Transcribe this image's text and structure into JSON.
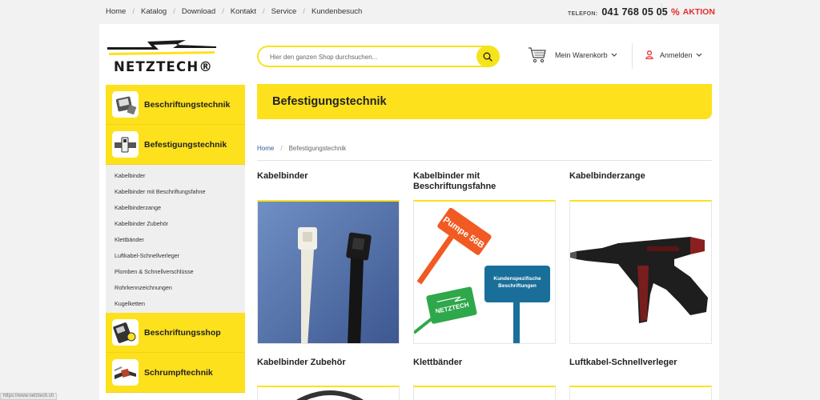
{
  "topnav": {
    "links": [
      "Home",
      "Katalog",
      "Download",
      "Kontakt",
      "Service",
      "Kundenbesuch"
    ],
    "phone_label": "TELEFON:",
    "phone_number": "041 768 05 05",
    "aktion_symbol": "%",
    "aktion_label": "AKTION"
  },
  "header": {
    "logo_text": "NETZTECH®",
    "search_placeholder": "Hier den ganzen Shop durchsuchen...",
    "cart_label": "Mein Warenkorb",
    "login_label": "Anmelden"
  },
  "sidebar": {
    "categories": [
      {
        "label": "Beschriftungstechnik",
        "icon": "label-tag-icon"
      },
      {
        "label": "Befestigungstechnik",
        "icon": "cable-tie-icon"
      }
    ],
    "subitems": [
      "Kabelbinder",
      "Kabelbinder mit Beschriftungsfahne",
      "Kabelbinderzange",
      "Kabelbinder Zubehör",
      "Klettbänder",
      "Luftkabel-Schnellverleger",
      "Plomben & Schnellverschlüsse",
      "Rohrkennzeichnungen",
      "Kugelketten"
    ],
    "categories_after": [
      {
        "label": "Beschriftungsshop",
        "icon": "label-printer-icon"
      },
      {
        "label": "Schrumpftechnik",
        "icon": "shrink-tube-icon"
      }
    ]
  },
  "main": {
    "page_title": "Befestigungstechnik",
    "breadcrumb": {
      "home": "Home",
      "separator": "/",
      "current": "Befestigungstechnik"
    },
    "products_row1": [
      {
        "title": "Kabelbinder",
        "image": "cable-ties-photo"
      },
      {
        "title": "Kabelbinder mit Beschriftungsfahne",
        "image": "cable-tie-flags-photo"
      },
      {
        "title": "Kabelbinderzange",
        "image": "cable-tie-gun-photo"
      }
    ],
    "products_row2": [
      {
        "title": "Kabelbinder Zubehör"
      },
      {
        "title": "Klettbänder"
      },
      {
        "title": "Luftkabel-Schnellverleger"
      }
    ],
    "flag_texts": {
      "orange": "Pumpe 56B",
      "blue_line1": "Kundenspezifische",
      "blue_line2": "Beschriftungen",
      "green": "NETZTECH"
    }
  },
  "status_bar": {
    "text": "https://www.netztech.ch"
  },
  "colors": {
    "brand_yellow": "#fde11c",
    "aktion_red": "#e52d2d",
    "link_blue": "#2e5d99"
  }
}
